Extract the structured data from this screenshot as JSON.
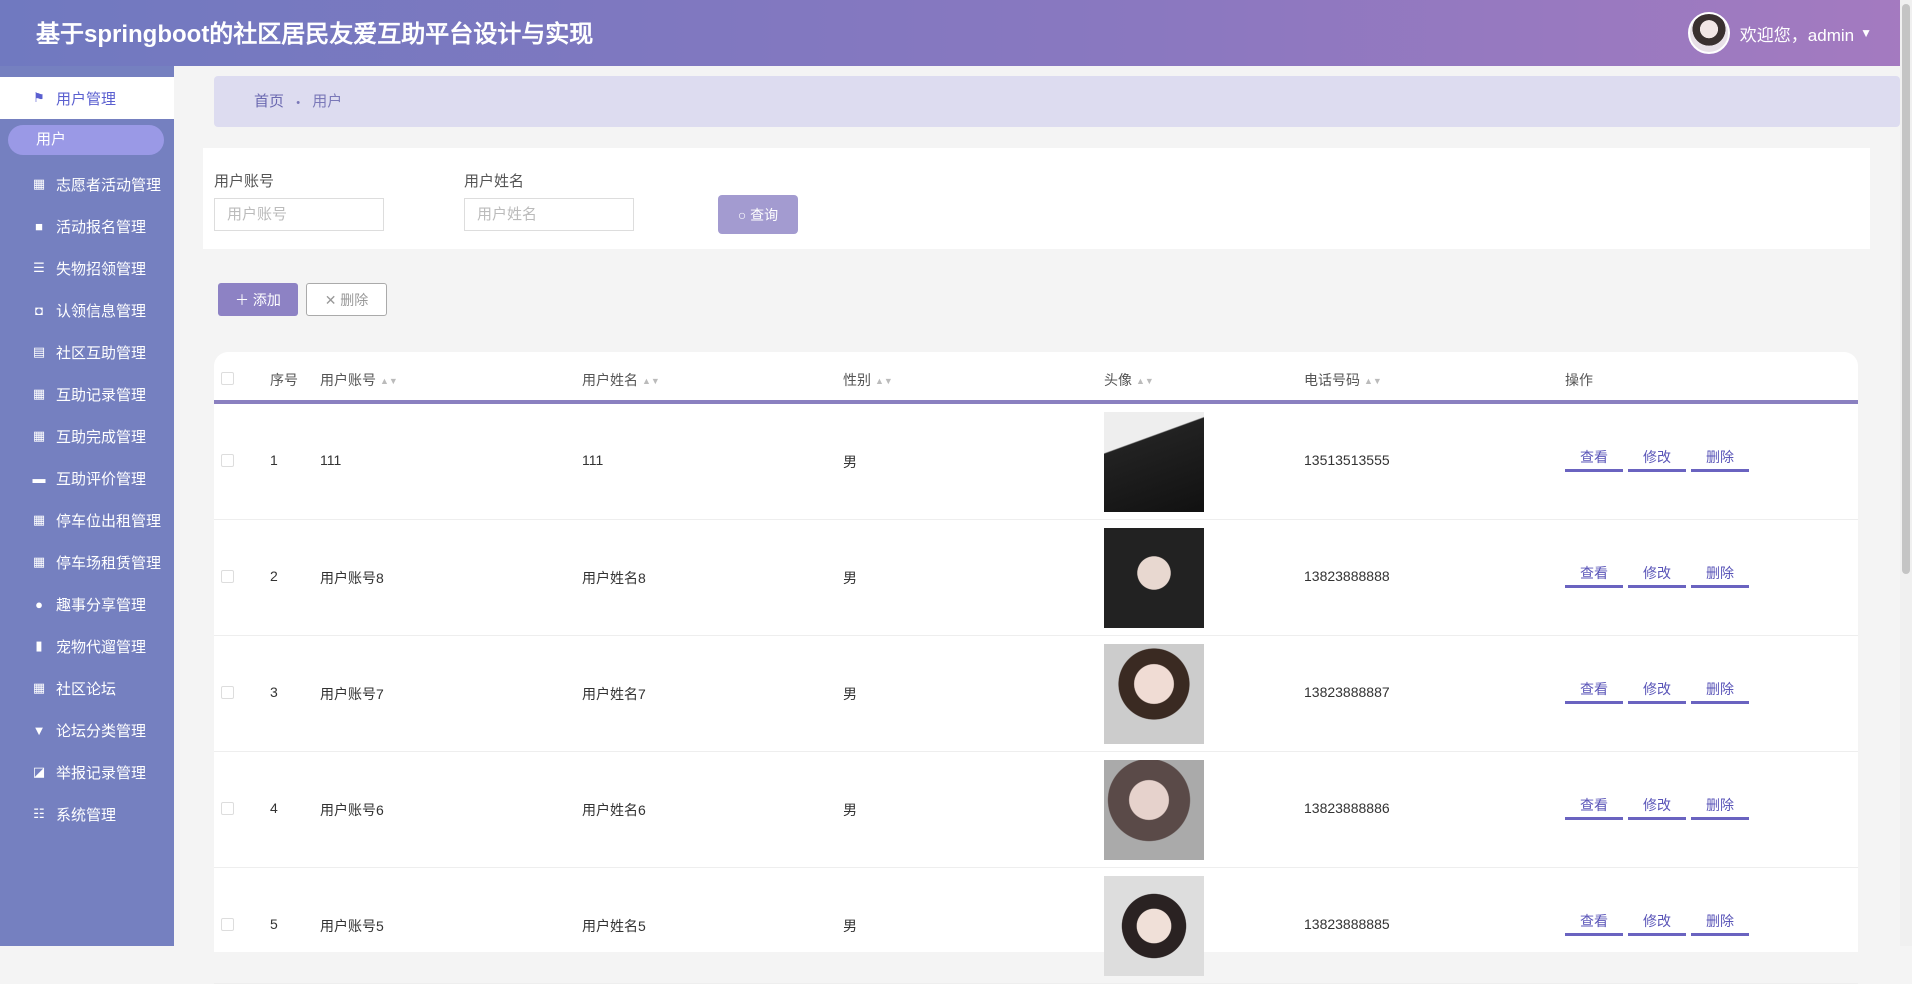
{
  "header": {
    "title": "基于springboot的社区居民友爱互助平台设计与实现",
    "welcome": "欢迎您，admin",
    "caret": "▼"
  },
  "sidebar": {
    "active": "用户管理",
    "sub": "用户",
    "items": [
      {
        "label": "志愿者活动管理",
        "icon": "grid-icon",
        "glyph": "▦"
      },
      {
        "label": "活动报名管理",
        "icon": "briefcase-icon",
        "glyph": "■"
      },
      {
        "label": "失物招领管理",
        "icon": "list-icon",
        "glyph": "☰"
      },
      {
        "label": "认领信息管理",
        "icon": "wallet-icon",
        "glyph": "◘"
      },
      {
        "label": "社区互助管理",
        "icon": "clipboard-icon",
        "glyph": "▤"
      },
      {
        "label": "互助记录管理",
        "icon": "grid-icon",
        "glyph": "▦"
      },
      {
        "label": "互助完成管理",
        "icon": "grid-icon",
        "glyph": "▦"
      },
      {
        "label": "互助评价管理",
        "icon": "ticket-icon",
        "glyph": "▬"
      },
      {
        "label": "停车位出租管理",
        "icon": "grid-icon",
        "glyph": "▦"
      },
      {
        "label": "停车场租赁管理",
        "icon": "grid-icon",
        "glyph": "▦"
      },
      {
        "label": "趣事分享管理",
        "icon": "user-icon",
        "glyph": "●"
      },
      {
        "label": "宠物代遛管理",
        "icon": "bar-chart-icon",
        "glyph": "▮"
      },
      {
        "label": "社区论坛",
        "icon": "grid-icon",
        "glyph": "▦"
      },
      {
        "label": "论坛分类管理",
        "icon": "brush-icon",
        "glyph": "▼"
      },
      {
        "label": "举报记录管理",
        "icon": "line-chart-icon",
        "glyph": "◪"
      },
      {
        "label": "系统管理",
        "icon": "sliders-icon",
        "glyph": "☷"
      }
    ]
  },
  "breadcrumb": {
    "home": "首页",
    "sep": "•",
    "current": "用户"
  },
  "search": {
    "account_label": "用户账号",
    "account_placeholder": "用户账号",
    "name_label": "用户姓名",
    "name_placeholder": "用户姓名",
    "query": "查询"
  },
  "toolbar": {
    "add": "＋ 添加",
    "delete": "✕ 删除"
  },
  "table": {
    "headers": [
      "序号",
      "用户账号",
      "用户姓名",
      "性别",
      "头像",
      "电话号码",
      "操作"
    ],
    "actions": [
      "查看",
      "修改",
      "删除"
    ],
    "rows": [
      {
        "no": "1",
        "account": "111",
        "name": "111",
        "gender": "男",
        "phone": "13513513555"
      },
      {
        "no": "2",
        "account": "用户账号8",
        "name": "用户姓名8",
        "gender": "男",
        "phone": "13823888888"
      },
      {
        "no": "3",
        "account": "用户账号7",
        "name": "用户姓名7",
        "gender": "男",
        "phone": "13823888887"
      },
      {
        "no": "4",
        "account": "用户账号6",
        "name": "用户姓名6",
        "gender": "男",
        "phone": "13823888886"
      },
      {
        "no": "5",
        "account": "用户账号5",
        "name": "用户姓名5",
        "gender": "男",
        "phone": "13823888885"
      }
    ]
  }
}
